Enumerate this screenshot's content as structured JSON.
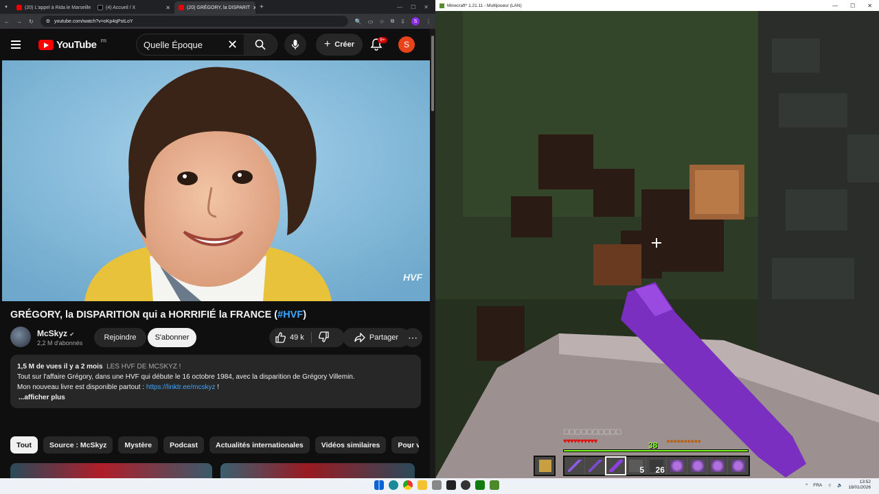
{
  "browser": {
    "tabs": [
      {
        "label": "(20) L'appel à Rida le Marseille"
      },
      {
        "label": "(4) Accueil / X"
      },
      {
        "label": "(20) GRÉGORY, la DISPARIT"
      }
    ],
    "url": "youtube.com/watch?v=oKp4qPstLoY",
    "profile_initial": "S"
  },
  "youtube": {
    "logo_text": "YouTube",
    "region": "FR",
    "search_value": "Quelle Époque",
    "create_label": "Créer",
    "notif_count": "9+",
    "avatar_initial": "S",
    "watermark": "HVF",
    "video": {
      "title_main": "GRÉGORY, la DISPARITION qui a HORRIFIÉ la FRANCE (",
      "title_tag": "#HVF",
      "title_end": ")",
      "channel": "McSkyz",
      "subscribers": "2,2 M d'abonnés",
      "join_label": "Rejoindre",
      "subscribe_label": "S'abonner",
      "likes": "49 k",
      "share_label": "Partager"
    },
    "description": {
      "views": "1,5 M de vues  il y a 2 mois",
      "hashtag": "LES HVF DE MCSKYZ !",
      "line1": "Tout sur l'affaire Grégory, dans une HVF qui débute le 16 octobre 1984, avec la disparition de Grégory Villemin.",
      "line2_prefix": "Mon nouveau livre est disponible partout : ",
      "link": "https://linktr.ee/mcskyz",
      "line2_suffix": " !",
      "more": "...afficher plus"
    },
    "chips": [
      "Tout",
      "Source : McSkyz",
      "Mystère",
      "Podcast",
      "Actualités internationales",
      "Vidéos similaires",
      "Pour v"
    ]
  },
  "minecraft": {
    "window_title": "Minecraft* 1.21.11 - Multijoueur (LAN)",
    "xp_level": "38",
    "xp_progress": 1.0,
    "hotbar_counts": {
      "slot5": "5",
      "slot6": "26"
    }
  },
  "taskbar": {
    "lang": "FRA",
    "time": "13:52",
    "date": "18/01/2026"
  }
}
